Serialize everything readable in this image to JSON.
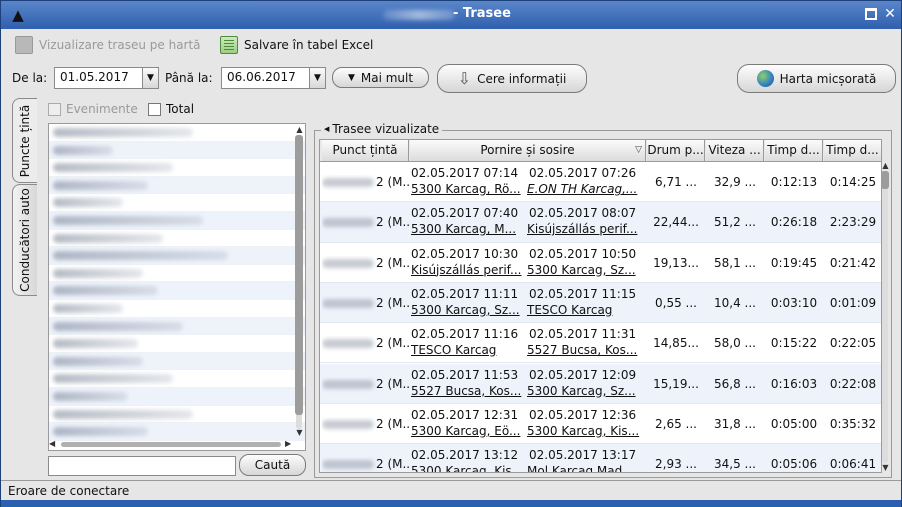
{
  "window": {
    "title": "- Trasee"
  },
  "toolbar": {
    "visualize_label": "Vizualizare traseu pe hartă",
    "excel_label": "Salvare în tabel Excel"
  },
  "filters": {
    "from_label": "De la:",
    "from_value": "01.05.2017",
    "to_label": "Până la:",
    "to_value": "06.06.2017",
    "more_label": "Mai mult",
    "info_label": "Cere informații",
    "map_label": "Harta micșorată"
  },
  "tabs": [
    {
      "label": "Puncte țintă"
    },
    {
      "label": "Conducători auto"
    }
  ],
  "left_panel": {
    "events_label": "Evenimente",
    "total_label": "Total",
    "search_button": "Caută",
    "search_value": ""
  },
  "routes": {
    "legend": "Trasee vizualizate",
    "columns": [
      "Punct țintă",
      "Pornire și sosire",
      "Drum p...",
      "Viteza ...",
      "Timp d...",
      "Timp d..."
    ],
    "rows": [
      {
        "point": "2 (M...",
        "start_time": "02.05.2017 07:14",
        "end_time": "02.05.2017 07:26",
        "start_place": "5300 Karcag, Rö...",
        "end_place": "E.ON TH Karcag,...",
        "distance": "6,71 ...",
        "speed": "32,9 ...",
        "time1": "0:12:13",
        "time2": "0:14:25"
      },
      {
        "point": "2 (M...",
        "start_time": "02.05.2017 07:40",
        "end_time": "02.05.2017 08:07",
        "start_place": "5300 Karcag, M...",
        "end_place": "Kisújszállás perif...",
        "distance": "22,44...",
        "speed": "51,2 ...",
        "time1": "0:26:18",
        "time2": "2:23:29"
      },
      {
        "point": "2 (M...",
        "start_time": "02.05.2017 10:30",
        "end_time": "02.05.2017 10:50",
        "start_place": "Kisújszállás perif...",
        "end_place": "5300 Karcag, Sz...",
        "distance": "19,13...",
        "speed": "58,1 ...",
        "time1": "0:19:45",
        "time2": "0:21:42"
      },
      {
        "point": "2 (M...",
        "start_time": "02.05.2017 11:11",
        "end_time": "02.05.2017 11:15",
        "start_place": "5300 Karcag, Sz...",
        "end_place": "TESCO Karcag",
        "distance": "0,55 ...",
        "speed": "10,4 ...",
        "time1": "0:03:10",
        "time2": "0:01:09"
      },
      {
        "point": "2 (M...",
        "start_time": "02.05.2017 11:16",
        "end_time": "02.05.2017 11:31",
        "start_place": "TESCO Karcag",
        "end_place": "5527 Bucsa, Kos...",
        "distance": "14,85...",
        "speed": "58,0 ...",
        "time1": "0:15:22",
        "time2": "0:22:05"
      },
      {
        "point": "2 (M...",
        "start_time": "02.05.2017 11:53",
        "end_time": "02.05.2017 12:09",
        "start_place": "5527 Bucsa, Kos...",
        "end_place": "5300 Karcag, Sz...",
        "distance": "15,19...",
        "speed": "56,8 ...",
        "time1": "0:16:03",
        "time2": "0:22:08"
      },
      {
        "point": "2 (M...",
        "start_time": "02.05.2017 12:31",
        "end_time": "02.05.2017 12:36",
        "start_place": "5300 Karcag, Eö...",
        "end_place": "5300 Karcag, Kis...",
        "distance": "2,65 ...",
        "speed": "31,8 ...",
        "time1": "0:05:00",
        "time2": "0:35:32"
      },
      {
        "point": "2 (M...",
        "start_time": "02.05.2017 13:12",
        "end_time": "02.05.2017 13:17",
        "start_place": "5300 Karcag, Kis...",
        "end_place": "Mol Karcag Mad...",
        "distance": "2,93 ...",
        "speed": "34,5 ...",
        "time1": "0:05:06",
        "time2": "0:06:41"
      }
    ]
  },
  "status_bar": {
    "text": "Eroare de conectare"
  },
  "colors": {
    "titlebar": "#2f5fae",
    "selection": "#bcd3ef",
    "row_alt": "#eef3fb"
  }
}
